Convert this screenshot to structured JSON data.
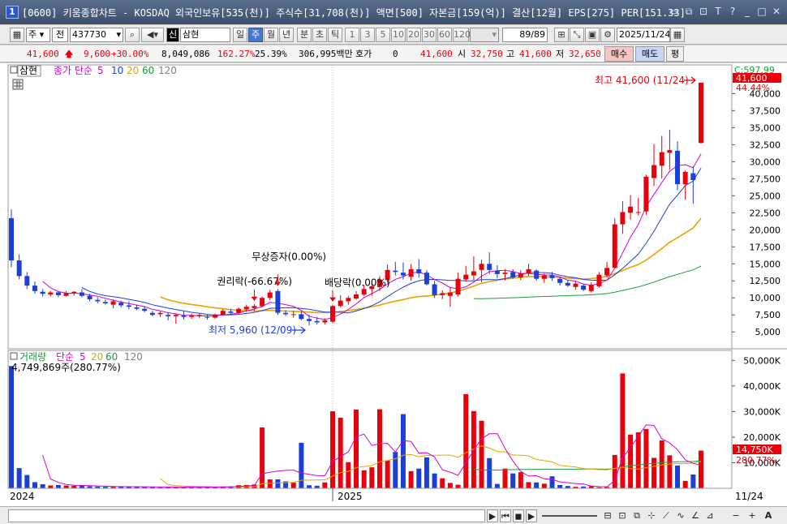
{
  "window": {
    "icon_label": "1",
    "title": "[0600] 키움종합차트 - KOSDAQ 외국인보유[535(천)] 주식수[31,708(천)] 액면[500] 자본금[159(억)] 결산[12월] EPS[275] PER[151.33] 시가총",
    "buttons": [
      "▭",
      "⧉",
      "⊡",
      "T",
      "?",
      "_",
      "□",
      "✕"
    ]
  },
  "toolbar": {
    "period_type": "주",
    "market": "전",
    "code": "437730",
    "name_badge": "신",
    "stock_name": "삼현",
    "intervals": [
      "일",
      "주",
      "월",
      "년",
      "분",
      "초",
      "틱"
    ],
    "active_interval": "주",
    "ticks": [
      "1",
      "3",
      "5",
      "10",
      "20",
      "30",
      "60",
      "120"
    ],
    "bar_count": "89",
    "bar_total": "/89",
    "date": "2025/11/24"
  },
  "quote": {
    "price": "41,600",
    "change": "9,600",
    "change_rate": "+30.00%",
    "volume": "8,049,086",
    "volume_ratio": "162.27%",
    "turnover": "25.39%",
    "trade_value": "306,995백만",
    "hoga_label": "호가",
    "hoga_value": "0",
    "hoga_price": "41,600",
    "open_label": "시",
    "open": "32,750",
    "high_label": "고",
    "high": "41,600",
    "low_label": "저",
    "low": "32,650",
    "buy_label": "매수",
    "sell_label": "매도",
    "eval_label": "평"
  },
  "price_panel": {
    "stock_label": "삼현",
    "ma_title": "종가 단순",
    "ma_periods": [
      "5",
      "10",
      "20",
      "60",
      "120"
    ],
    "right_top": "C:597.99",
    "current_tag": "41,600",
    "current_pct": "44.44%",
    "high_annotation": "최고 41,600 (11/24)",
    "low_annotation": "최저 5,960 (12/09)",
    "events": [
      "권리락(-66.67%)",
      "무상증자(0.00%)",
      "배당락(0.00%)"
    ]
  },
  "volume_panel": {
    "title": "거래량",
    "ma_title": "단순",
    "ma_periods": [
      "5",
      "20",
      "60",
      "120"
    ],
    "current_text": "4,749,869주(280.77%)",
    "current_tag": "14,750K",
    "current_pct": "280.77%"
  },
  "chart_data": {
    "type": "candlestick",
    "x_start_label": "2024",
    "x_mid_label": "2025",
    "x_end_label": "11/24",
    "price_axis": {
      "ticks": [
        5000,
        7500,
        10000,
        12500,
        15000,
        17500,
        20000,
        22500,
        25000,
        27500,
        30000,
        32500,
        35000,
        37500,
        40000
      ],
      "tick_labels": [
        "5,000",
        "7,500",
        "10,000",
        "12,500",
        "15,000",
        "17,500",
        "20,000",
        "22,500",
        "25,000",
        "27,500",
        "30,000",
        "32,500",
        "35,000",
        "37,500",
        "40,000"
      ],
      "ylim": [
        3000,
        43500
      ]
    },
    "volume_axis": {
      "ticks": [
        10000,
        20000,
        30000,
        40000,
        50000
      ],
      "tick_labels": [
        "10,000K",
        "20,000K",
        "30,000K",
        "40,000K",
        "50,000K"
      ],
      "ylim": [
        0,
        52000
      ]
    },
    "colors": {
      "up": "#e8000b",
      "down": "#1c3fd6",
      "ma5": "#d400d4",
      "ma10": "#1c3fd6",
      "ma20": "#e6a400",
      "ma60": "#1e9a3f",
      "ma120": "#808080"
    },
    "candles": [
      [
        21700,
        23000,
        14500,
        15500
      ],
      [
        15500,
        16400,
        12700,
        13200
      ],
      [
        13200,
        13800,
        11300,
        11800
      ],
      [
        11800,
        12400,
        10600,
        11000
      ],
      [
        10900,
        11300,
        10200,
        10600
      ],
      [
        10500,
        11000,
        10200,
        10800
      ],
      [
        10800,
        11000,
        10100,
        10400
      ],
      [
        10300,
        11000,
        10200,
        10700
      ],
      [
        10700,
        11000,
        10300,
        10900
      ],
      [
        10800,
        11300,
        10100,
        10300
      ],
      [
        10300,
        10600,
        9500,
        9800
      ],
      [
        9700,
        10100,
        9200,
        9500
      ],
      [
        9400,
        9800,
        9000,
        9200
      ],
      [
        9000,
        9800,
        8500,
        9500
      ],
      [
        9300,
        9600,
        8600,
        8900
      ],
      [
        8900,
        9500,
        8300,
        8700
      ],
      [
        8600,
        9000,
        8200,
        8400
      ],
      [
        8400,
        8800,
        7900,
        8100
      ],
      [
        7800,
        8100,
        7300,
        7500
      ],
      [
        7600,
        8000,
        7200,
        7800
      ],
      [
        7500,
        7900,
        6700,
        7300
      ],
      [
        7300,
        7700,
        6200,
        7500
      ],
      [
        7400,
        8000,
        6800,
        7200
      ],
      [
        7200,
        7700,
        6900,
        7400
      ],
      [
        7300,
        7700,
        7000,
        7500
      ],
      [
        7200,
        7600,
        6800,
        7100
      ],
      [
        7100,
        7700,
        6900,
        7500
      ],
      [
        7500,
        8400,
        7400,
        8100
      ],
      [
        8000,
        8400,
        7500,
        7800
      ],
      [
        7800,
        8600,
        7600,
        8400
      ],
      [
        8300,
        9000,
        7900,
        8700
      ],
      [
        8500,
        9100,
        8000,
        8800
      ],
      [
        8800,
        10200,
        8600,
        10000
      ],
      [
        10000,
        11200,
        9700,
        10800
      ],
      [
        11000,
        11300,
        7500,
        7800
      ],
      [
        7800,
        8200,
        7300,
        7600
      ],
      [
        7500,
        8100,
        7100,
        7600
      ],
      [
        7600,
        8000,
        6700,
        6900
      ],
      [
        6900,
        7500,
        5960,
        6600
      ],
      [
        6600,
        7200,
        6100,
        6400
      ],
      [
        6400,
        7000,
        6100,
        6700
      ],
      [
        6500,
        9000,
        6300,
        8800
      ],
      [
        8800,
        10400,
        8600,
        9600
      ],
      [
        9500,
        10300,
        9000,
        10000
      ],
      [
        9900,
        11000,
        9700,
        10500
      ],
      [
        10500,
        11900,
        10300,
        11300
      ],
      [
        11300,
        12100,
        10300,
        11700
      ],
      [
        11600,
        13200,
        11000,
        12700
      ],
      [
        12600,
        14900,
        12200,
        14100
      ],
      [
        14000,
        15300,
        13300,
        13800
      ],
      [
        13700,
        15200,
        12700,
        13300
      ],
      [
        13100,
        15000,
        12500,
        14200
      ],
      [
        14200,
        15700,
        13000,
        13600
      ],
      [
        13700,
        14100,
        11800,
        12000
      ],
      [
        12000,
        12500,
        10000,
        10400
      ],
      [
        10400,
        11100,
        9800,
        10700
      ],
      [
        10300,
        11600,
        8700,
        10800
      ],
      [
        10500,
        13700,
        10200,
        12800
      ],
      [
        12700,
        14700,
        12400,
        13400
      ],
      [
        13300,
        16100,
        12600,
        13900
      ],
      [
        14100,
        15600,
        12300,
        15000
      ],
      [
        15000,
        16700,
        13500,
        14100
      ],
      [
        14000,
        14800,
        12900,
        13500
      ],
      [
        13500,
        14200,
        12600,
        13700
      ],
      [
        13800,
        14200,
        12800,
        13000
      ],
      [
        13000,
        14100,
        12600,
        13600
      ],
      [
        13600,
        15000,
        13200,
        14200
      ],
      [
        14000,
        14200,
        12500,
        12800
      ],
      [
        12800,
        13600,
        12200,
        13300
      ],
      [
        13300,
        13800,
        12500,
        12900
      ],
      [
        12800,
        13100,
        11800,
        12200
      ],
      [
        12200,
        12600,
        11600,
        11800
      ],
      [
        11600,
        12400,
        11200,
        12100
      ],
      [
        11800,
        12100,
        11000,
        11200
      ],
      [
        11000,
        12300,
        10800,
        11900
      ],
      [
        11700,
        13800,
        11500,
        13400
      ],
      [
        13300,
        15300,
        13000,
        14400
      ],
      [
        14400,
        21700,
        14300,
        20800
      ],
      [
        20800,
        24200,
        19400,
        22600
      ],
      [
        22500,
        25100,
        21500,
        23400
      ],
      [
        22500,
        24700,
        22100,
        22600
      ],
      [
        22700,
        28100,
        22200,
        27800
      ],
      [
        27600,
        32600,
        26400,
        29500
      ],
      [
        29400,
        33800,
        27500,
        31400
      ],
      [
        31300,
        34700,
        28800,
        31700
      ],
      [
        31600,
        33000,
        25800,
        26700
      ],
      [
        26700,
        28700,
        24400,
        28500
      ],
      [
        28300,
        29300,
        23800,
        27300
      ],
      [
        32750,
        41600,
        32650,
        41600
      ]
    ],
    "volume_k": [
      47800,
      7900,
      5200,
      2400,
      1600,
      1100,
      1300,
      1100,
      1000,
      1000,
      800,
      700,
      600,
      600,
      700,
      500,
      700,
      500,
      500,
      400,
      400,
      500,
      500,
      500,
      400,
      400,
      500,
      700,
      800,
      1200,
      1300,
      1500,
      23800,
      3500,
      3500,
      2700,
      2200,
      17800,
      1200,
      1000,
      2300,
      30100,
      27600,
      10200,
      30800,
      7000,
      8200,
      30900,
      10900,
      14200,
      29000,
      6700,
      7700,
      12100,
      5800,
      3900,
      2100,
      1400,
      36800,
      30200,
      26400,
      11800,
      1700,
      7700,
      5800,
      6300,
      2400,
      2300,
      1800,
      4700,
      1300,
      900,
      600,
      700,
      800,
      400,
      500,
      13000,
      44900,
      21000,
      21900,
      23200,
      11900,
      18700,
      12900,
      8900,
      2900,
      5400,
      14750
    ],
    "x_labels_index": {
      "2024": 0,
      "2025": 41
    },
    "events_index": {
      "권리락(-66.67%)": 31,
      "무상증자(0.00%)": 34,
      "배당락(0.00%)": 41
    }
  },
  "bottom": {
    "buttons": [
      "▶",
      "⏮",
      "◼",
      "▶",
      "−",
      "+",
      "A"
    ]
  }
}
